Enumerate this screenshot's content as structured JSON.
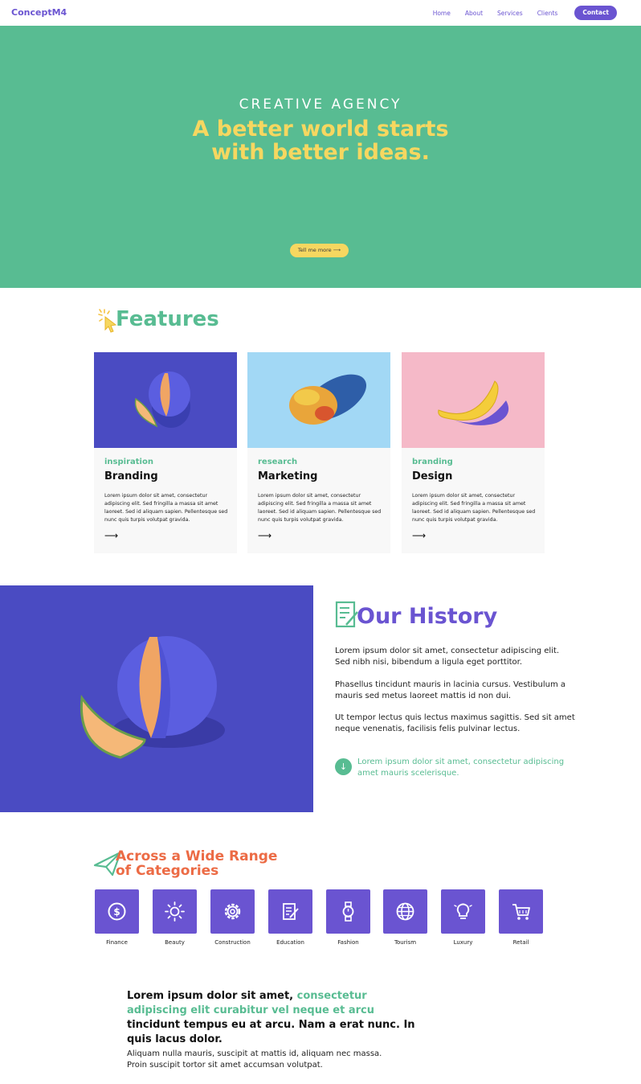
{
  "nav": {
    "brand": "ConceptM4",
    "links": [
      "Home",
      "About",
      "Services",
      "Clients"
    ],
    "cta": "Contact"
  },
  "hero": {
    "kicker": "CREATIVE AGENCY",
    "title_line1": "A better world starts",
    "title_line2": "with better ideas.",
    "button": "Tell me more",
    "button_icon": "arrow-right-icon"
  },
  "features": {
    "title": "Features",
    "cards": [
      {
        "category": "inspiration",
        "title": "Branding",
        "body": "Lorem ipsum dolor sit amet, consectetur adipiscing elit. Sed fringilla a massa sit amet laoreet. Sed id aliquam sapien. Pellentesque sed nunc quis turpis volutpat gravida.",
        "image_bg": "#4a4bc2"
      },
      {
        "category": "research",
        "title": "Marketing",
        "body": "Lorem ipsum dolor sit amet, consectetur adipiscing elit. Sed fringilla a massa sit amet laoreet. Sed id aliquam sapien. Pellentesque sed nunc quis turpis volutpat gravida.",
        "image_bg": "#a2d8f5"
      },
      {
        "category": "branding",
        "title": "Design",
        "body": "Lorem ipsum dolor sit amet, consectetur adipiscing elit. Sed fringilla a massa sit amet laoreet. Sed id aliquam sapien. Pellentesque sed nunc quis turpis volutpat gravida.",
        "image_bg": "#f5b9c8"
      }
    ]
  },
  "history": {
    "title": "Our History",
    "paragraphs": [
      "Lorem ipsum dolor sit amet, consectetur adipiscing elit. Sed nibh nisi, bibendum a ligula eget  porttitor.",
      "Phasellus tincidunt mauris in lacinia cursus. Vestibulum a mauris sed metus laoreet mattis id non dui.",
      "Ut tempor lectus quis lectus maximus sagittis. Sed sit amet neque venenatis, facilisis felis pulvinar lectus."
    ],
    "note": "Lorem ipsum dolor sit amet, consectetur adipiscing amet mauris scelerisque.",
    "note_icon": "arrow-down-icon"
  },
  "categories": {
    "title_line1": "Across a Wide Range",
    "title_line2": "of Categories",
    "items": [
      {
        "label": "Finance",
        "icon": "dollar-icon"
      },
      {
        "label": "Beauty",
        "icon": "sun-icon"
      },
      {
        "label": "Construction",
        "icon": "gear-icon"
      },
      {
        "label": "Education",
        "icon": "document-edit-icon"
      },
      {
        "label": "Fashion",
        "icon": "watch-icon"
      },
      {
        "label": "Tourism",
        "icon": "globe-icon"
      },
      {
        "label": "Luxury",
        "icon": "lightbulb-icon"
      },
      {
        "label": "Retail",
        "icon": "cart-icon"
      }
    ]
  },
  "bottom": {
    "lead_part1": "Lorem ipsum dolor sit amet, ",
    "lead_accent": "consectetur adipiscing elit curabitur vel neque et arcu",
    "lead_part2": " tincidunt tempus eu at arcu. Nam a erat nunc. In quis lacus dolor.",
    "paragraph": "Aliquam nulla mauris, suscipit at mattis id, aliquam nec massa. Proin suscipit tortor sit amet accumsan volutpat."
  },
  "colors": {
    "purple": "#6a54d1",
    "green": "#58bc92",
    "yellow": "#f6d760",
    "orange": "#ec6b45"
  }
}
